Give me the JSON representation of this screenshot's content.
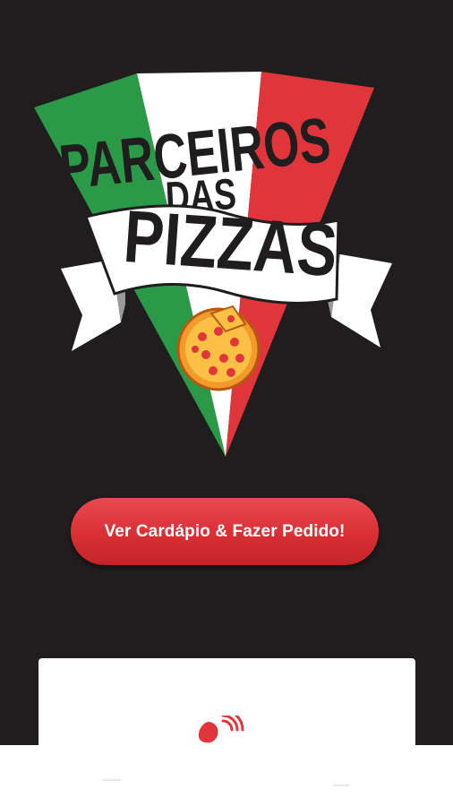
{
  "logo": {
    "line1": "PARCEIROS",
    "line2": "DAS",
    "line3": "PIZZAS"
  },
  "menu_button": {
    "label": "Ver Cardápio & Fazer Pedido!"
  },
  "card": {
    "icon": "delivery-pizza-icon"
  },
  "colors": {
    "background": "#1f1d1e",
    "italian_green": "#2a9a48",
    "italian_white": "#ffffff",
    "italian_red": "#e0353a",
    "button_red": "#d92f35",
    "pizza_orange": "#f49a2a",
    "pepperoni": "#e0353a"
  }
}
